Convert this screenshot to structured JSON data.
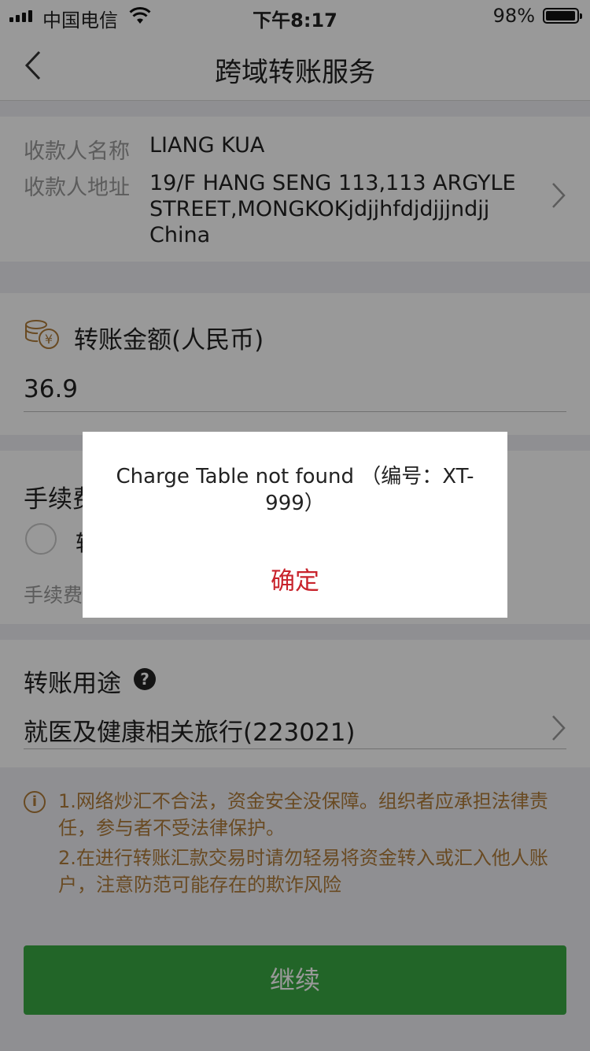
{
  "status_bar": {
    "carrier": "中国电信",
    "time": "下午8:17",
    "battery_percent": "98%",
    "battery_level": 0.98
  },
  "nav": {
    "title": "跨域转账服务"
  },
  "payee": {
    "name_label": "收款人名称",
    "name_value": "LIANG KUA",
    "address_label": "收款人地址",
    "address_value": "19/F HANG SENG 113,113 ARGYLE STREET,MONGKOKjdjjhfdjdjjjndjj China"
  },
  "amount": {
    "label": "转账金额(人民币)",
    "value": "36.9"
  },
  "fee": {
    "label": "手续费",
    "radio_label": "转",
    "note": "手续费"
  },
  "purpose": {
    "label": "转账用途",
    "help": "?",
    "value": "就医及健康相关旅行(223021)"
  },
  "notice": {
    "icon": "i",
    "items": [
      "1.网络炒汇不合法，资金安全没保障。组织者应承担法律责任，参与者不受法律保护。",
      "2.在进行转账汇款交易时请勿轻易将资金转入或汇入他人账户，注意防范可能存在的欺诈风险"
    ]
  },
  "continue_button": "继续",
  "dialog": {
    "message": "Charge Table not found （编号：XT-999）",
    "ok": "确定"
  },
  "colors": {
    "primary_green": "#39a944",
    "warning_text": "#b07c3a",
    "dialog_ok": "#c8232c"
  }
}
